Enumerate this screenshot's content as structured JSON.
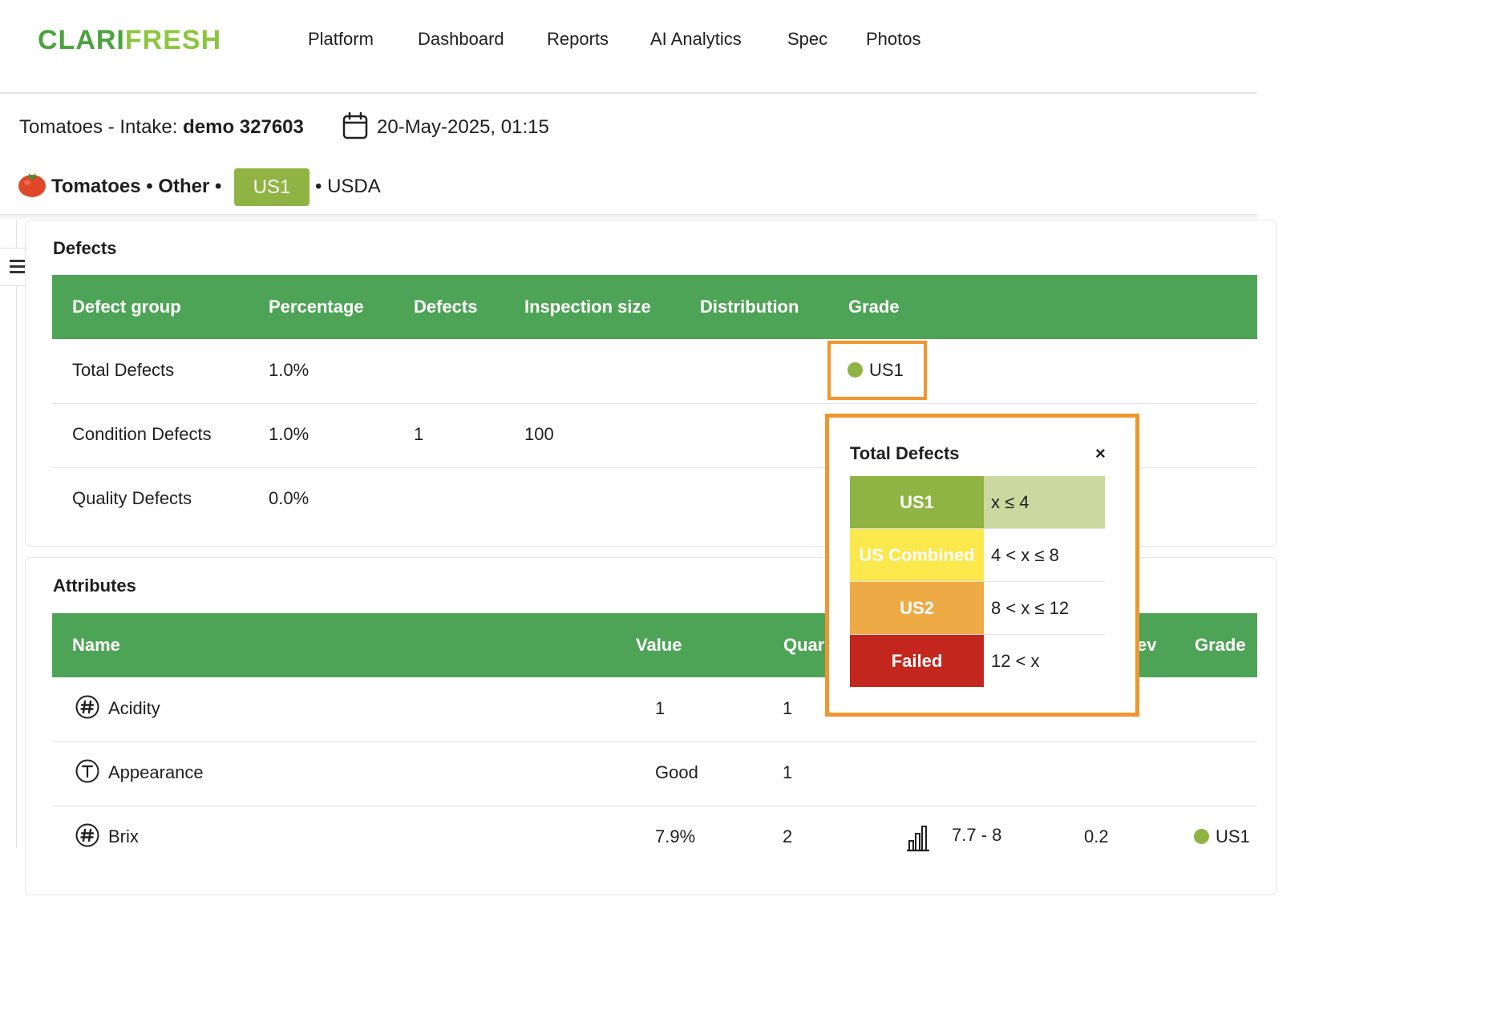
{
  "nav": {
    "logo_part1": "CLARI",
    "logo_part2": "FRESH",
    "items": [
      {
        "label": "Platform"
      },
      {
        "label": "Dashboard"
      },
      {
        "label": "Reports"
      },
      {
        "label": "AI Analytics"
      },
      {
        "label": "Spec"
      },
      {
        "label": "Photos"
      }
    ]
  },
  "header": {
    "intake_prefix": "Tomatoes - Intake: ",
    "intake_id": "demo 327603",
    "date": "20-May-2025, 01:15",
    "product": "Tomatoes • Other •",
    "grade": "US1",
    "standard": "• USDA"
  },
  "defects": {
    "title": "Defects",
    "columns": [
      "Defect group",
      "Percentage",
      "Defects",
      "Inspection size",
      "Distribution",
      "Grade"
    ],
    "rows": [
      {
        "group": "Total Defects",
        "percentage": "1.0%",
        "defects": "",
        "inspection_size": "",
        "distribution": "",
        "grade": "US1"
      },
      {
        "group": "Condition Defects",
        "percentage": "1.0%",
        "defects": "1",
        "inspection_size": "100",
        "distribution": "",
        "grade": ""
      },
      {
        "group": "Quality Defects",
        "percentage": "0.0%",
        "defects": "",
        "inspection_size": "",
        "distribution": "",
        "grade": ""
      }
    ]
  },
  "attributes": {
    "title": "Attributes",
    "columns": [
      "Name",
      "Value",
      "Quar",
      "ev",
      "Grade"
    ],
    "rows": [
      {
        "icon": "hash-icon",
        "name": "Acidity",
        "value": "1",
        "quantity": "1",
        "range": "",
        "stdev": "",
        "grade": ""
      },
      {
        "icon": "text-icon",
        "name": "Appearance",
        "value": "Good",
        "quantity": "1",
        "range": "",
        "stdev": "",
        "grade": ""
      },
      {
        "icon": "hash-icon",
        "name": "Brix",
        "value": "7.9%",
        "quantity": "2",
        "range": "7.7 - 8",
        "stdev": "0.2",
        "grade": "US1"
      }
    ]
  },
  "popover": {
    "title": "Total Defects",
    "close": "×",
    "grades": [
      {
        "label": "US1",
        "rule": "x ≤ 4",
        "color": "#8fb443",
        "active": true
      },
      {
        "label": "US Combined",
        "rule": "4 < x ≤ 8",
        "color": "#fbe84d",
        "active": false
      },
      {
        "label": "US2",
        "rule": "8 < x ≤ 12",
        "color": "#eeaa45",
        "active": false
      },
      {
        "label": "Failed",
        "rule": "12 < x",
        "color": "#c3261c",
        "active": false
      }
    ]
  },
  "colors": {
    "brand_dark": "#4aa33d",
    "brand_light": "#8cc63f",
    "table_header": "#4ea456",
    "grade_us1": "#8fb443",
    "highlight": "#f0962e"
  }
}
